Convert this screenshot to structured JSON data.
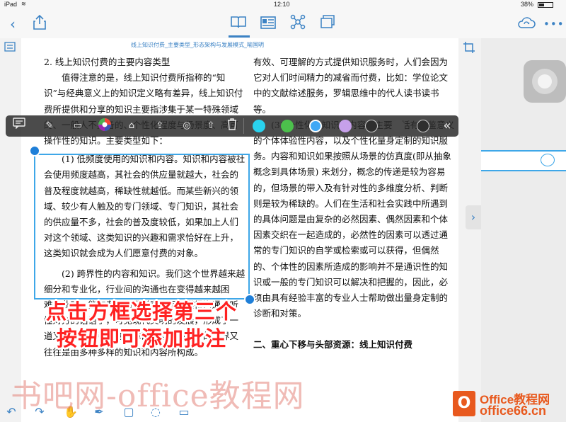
{
  "status": {
    "device": "iPad",
    "time": "12:10",
    "battery": "38%"
  },
  "breadcrumb": "线上知识付费_主要类型_形态架构与发展模式_喻国明",
  "doc": {
    "left_paragraphs": [
      "2. 线上知识付费的主要内容类型",
      "　　值得注意的是，线上知识付费所指称的“知识”与经典意义上的知识定义略有差异，线上知识付费所提供和分享的知识主要指涉集于某一特殊领域的、一般人不具备的、个性化程度与场景度、高可操作性的知识。主要类型如下：",
      "　　(1) 低频度使用的知识和内容。知识和内容被社会使用频度越高，其社会的供应量就越大，社会的普及程度就越高，稀缺性就越低。而某些新兴的领域、较少有人触及的专门领域、专门知识，其社会的供应量不多，社会的普及度较低，如果加上人们对这个领域、这类知识的兴趣和需求恰好在上升，这类知识就会成为人们愿意付费的对象。",
      "　　(2) 跨界性的内容和知识。我们这个世界越来越细分和专业化，行业间的沟通也在变得越来越困难。此时，能在专家和数学家之间都懂得沟通、听懂对方的话语了，可见现代文明的发展，形成了一道又一道认知和沟通的障碍，但人们面对的世界又往往是由多种多样的知识和内容所构成。"
    ],
    "right_paragraphs": [
      "有效、可理解的方式提供知识服务时，人们会因为它对人们时间精力的减省而付费，比如：学位论文中的文献综述服务，罗辑思维中的代人读书读书等。",
      "　　(3) 个性化的知识和内容。主要包括有借鉴意义的个体体验性内容，以及个性化量身定制的知识服务。内容和知识如果按照从场景的仿真度(即从抽象概念到具体场景) 来划分，概念的传递是较为容易的，但场景的带入及有针对性的多维度分析、判断则是较为稀缺的。人们在生活和社会实践中所遇到的具体问题是由复杂的必然因素、偶然因素和个体因素交织在一起造成的，必然性的因素可以透过通常的专门知识的自学或检索或可以获得，但偶然的、个体性的因素所造成的影响并不是通识性的知识或一般的专门知识可以解决和把握的，因此，必须由具有经验丰富的专业人士帮助做出量身定制的诊断和对策。",
      "二、重心下移与头部资源：线上知识付费"
    ]
  },
  "caption": {
    "line1": "点击方框选择第三个",
    "line2": "按钮即可添加批注"
  },
  "watermark": "书吧网-office教程网",
  "brand": {
    "top": "Office教程网",
    "bottom": "office66.cn"
  },
  "colors": {
    "accent": "#3b82c4",
    "selection": "#3ea7e8",
    "caption": "#ff2222",
    "brand": "#e8591e"
  },
  "toolbar_icons": [
    "back-icon",
    "share-icon",
    "book-icon",
    "layout-icon",
    "mindmap-icon",
    "pages-icon",
    "cloud-sync-icon",
    "more-icon"
  ],
  "float_toolbar_icons": [
    "comment-icon",
    "pen-icon",
    "highlighter-icon",
    "color-wheel-icon",
    "tag-icon",
    "share-icon",
    "search-icon",
    "export-icon",
    "delete-icon",
    "collapse-icon"
  ],
  "swatches": [
    "#29d2ee",
    "#4cc04c",
    "#3fa8f5",
    "#c6a0ea",
    "#2e2e2e",
    "#4c4c4c",
    "#2e2e2e"
  ],
  "bottom_icons": [
    "undo-icon",
    "redo-icon",
    "hand-icon",
    "pen-icon",
    "rectangle-icon",
    "lasso-icon",
    "comment-icon"
  ]
}
